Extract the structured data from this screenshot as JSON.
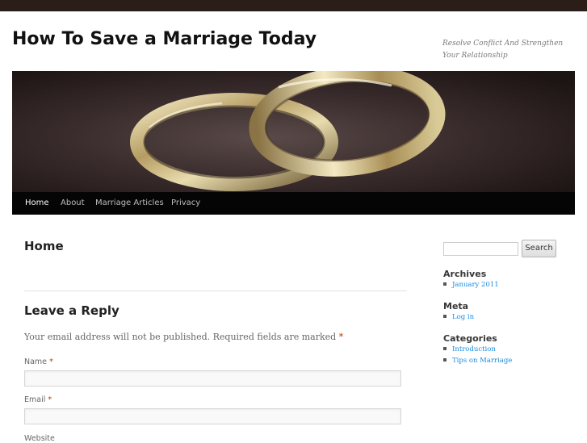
{
  "site": {
    "title": "How To Save a Marriage Today",
    "description": "Resolve Conflict And Strengthen Your Relationship"
  },
  "nav": {
    "items": [
      {
        "label": "Home",
        "active": true
      },
      {
        "label": "About"
      },
      {
        "label": "Marriage Articles"
      },
      {
        "label": "Privacy"
      }
    ]
  },
  "page": {
    "title": "Home"
  },
  "reply": {
    "title": "Leave a Reply",
    "notes": "Your email address will not be published. Required fields are marked",
    "required_mark": "*",
    "fields": [
      {
        "label": "Name",
        "required": "*",
        "value": ""
      },
      {
        "label": "Email",
        "required": "*",
        "value": ""
      },
      {
        "label": "Website"
      }
    ]
  },
  "sidebar": {
    "search": {
      "value": "",
      "button_label": "Search"
    },
    "archives": {
      "title": "Archives",
      "items": [
        "January 2011"
      ]
    },
    "meta": {
      "title": "Meta",
      "items": [
        "Log in"
      ]
    },
    "categories": {
      "title": "Categories",
      "items": [
        "Introduction",
        "Tips on Marriage"
      ]
    }
  },
  "colors": {
    "topbar": "#2b1e18",
    "nav_bg": "#050505",
    "link": "#1b8be0",
    "required": "#bd3500"
  }
}
